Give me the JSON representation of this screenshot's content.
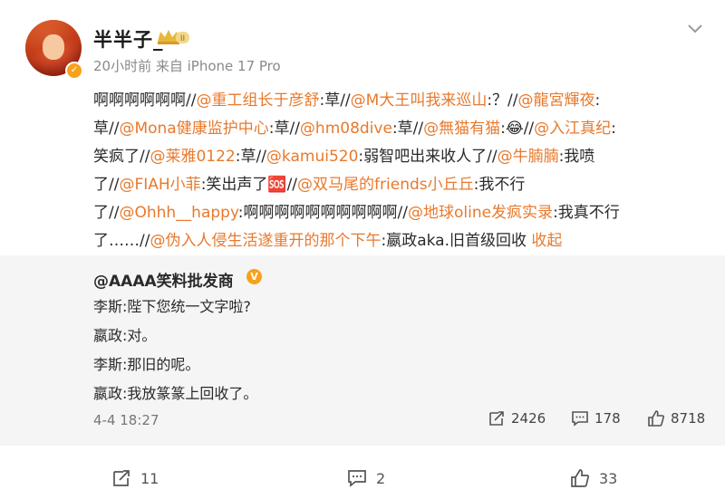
{
  "post": {
    "author": "半半子_",
    "level_badge": "II",
    "meta": "20小时前  来自 iPhone 17 Pro",
    "lines": [
      [
        {
          "t": "啊啊啊啊啊啊//"
        },
        {
          "m": "@重工组长于彦舒"
        },
        {
          "t": ":草//"
        },
        {
          "m": "@M大王叫我来巡山"
        },
        {
          "t": ":？//"
        },
        {
          "m": "@龍宮輝夜"
        },
        {
          "t": ":"
        }
      ],
      [
        {
          "t": "草//"
        },
        {
          "m": "@Mona健康监护中心"
        },
        {
          "t": ":草//"
        },
        {
          "m": "@hm08dive"
        },
        {
          "t": ":草//"
        },
        {
          "m": "@無猫有猫"
        },
        {
          "t": ":😂//"
        },
        {
          "m": "@入江真纪"
        },
        {
          "t": ":"
        }
      ],
      [
        {
          "t": "笑疯了//"
        },
        {
          "m": "@莱雅0122"
        },
        {
          "t": ":草//"
        },
        {
          "m": "@kamui520"
        },
        {
          "t": ":弱智吧出来收人了//"
        },
        {
          "m": "@牛腩腩"
        },
        {
          "t": ":我喷"
        }
      ],
      [
        {
          "t": "了//"
        },
        {
          "m": "@FIAH小菲"
        },
        {
          "t": ":笑出声了🆘//"
        },
        {
          "m": "@双马尾的friends小丘丘"
        },
        {
          "t": ":我不行"
        }
      ],
      [
        {
          "t": "了//"
        },
        {
          "m": "@Ohhh__happy"
        },
        {
          "t": ":啊啊啊啊啊啊啊啊啊啊//"
        },
        {
          "m": "@地球oline发疯实录"
        },
        {
          "t": ":我真不行"
        }
      ],
      [
        {
          "t": "了……//"
        },
        {
          "m": "@伪入人侵生活遂重开的那个下午"
        },
        {
          "t": ":嬴政aka.旧首级回收 "
        },
        {
          "m": "收起"
        }
      ]
    ]
  },
  "quote": {
    "author": "@AAAA笑料批发商",
    "badge": "V",
    "lines": [
      "李斯:陛下您统一文字啦?",
      "嬴政:对。",
      "李斯:那旧的呢。",
      "嬴政:我放篆篆上回收了。"
    ],
    "date": "4-4 18:27",
    "reposts": "2426",
    "comments": "178",
    "likes": "8718"
  },
  "footer": {
    "reposts": "11",
    "comments": "2",
    "likes": "33"
  },
  "colors": {
    "mention": "#e8792c",
    "badge": "#f7a21b",
    "quote_bg": "#f5f5f5"
  }
}
